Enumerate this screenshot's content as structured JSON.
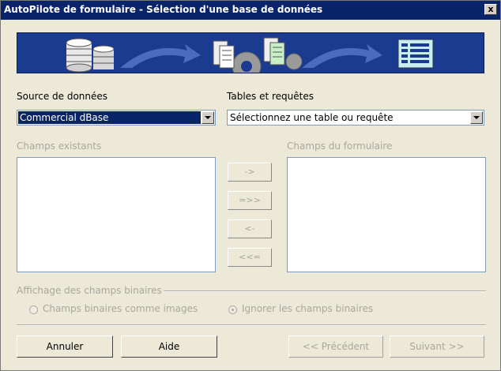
{
  "window": {
    "title": "AutoPilote de formulaire - Sélection d'une base de données",
    "close_label": "x"
  },
  "source": {
    "label": "Source de données",
    "value": "Commercial dBase"
  },
  "tables": {
    "label": "Tables et requêtes",
    "value": "Sélectionnez une table ou requête"
  },
  "fields": {
    "existing_label": "Champs existants",
    "form_label": "Champs du formulaire"
  },
  "move_buttons": {
    "add_one": "->",
    "add_all": "=>>",
    "remove_one": "<-",
    "remove_all": "<<="
  },
  "binary": {
    "group_label": "Affichage des champs binaires",
    "as_images": "Champs binaires comme images",
    "ignore": "Ignorer les champs binaires"
  },
  "footer": {
    "cancel": "Annuler",
    "help": "Aide",
    "previous": "<< Précédent",
    "next": "Suivant >>"
  },
  "colors": {
    "title_bar": "#0a246a",
    "banner": "#1a3b8f",
    "selection": "#0a246a"
  }
}
